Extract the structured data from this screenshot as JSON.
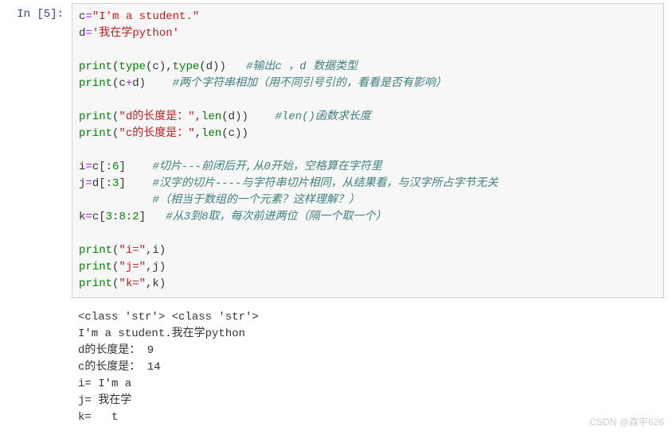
{
  "prompt": "In  [5]:",
  "code": {
    "l1_var": "c",
    "l1_eq": "=",
    "l1_str": "\"I'm a student.\"",
    "l2_var": "d",
    "l2_eq": "=",
    "l2_str": "'我在学python'",
    "l4_print": "print",
    "l4_p1": "(",
    "l4_type1": "type",
    "l4_p2": "(c),",
    "l4_type2": "type",
    "l4_p3": "(d))   ",
    "l4_comment": "#输出c ，d 数据类型",
    "l5_print": "print",
    "l5_p1": "(c",
    "l5_plus": "+",
    "l5_p2": "d)    ",
    "l5_comment": "#两个字符串相加（用不同引号引的，看看是否有影响）",
    "l7_print": "print",
    "l7_p1": "(",
    "l7_str": "\"d的长度是：\"",
    "l7_p2": ",",
    "l7_len": "len",
    "l7_p3": "(d))    ",
    "l7_comment": "#len()函数求长度",
    "l8_print": "print",
    "l8_p1": "(",
    "l8_str": "\"c的长度是：\"",
    "l8_p2": ",",
    "l8_len": "len",
    "l8_p3": "(c))",
    "l10_var": "i",
    "l10_eq": "=",
    "l10_c": "c[:",
    "l10_num": "6",
    "l10_b": "]    ",
    "l10_comment": "#切片---前闭后开,从0开始，空格算在字符里",
    "l11_var": "j",
    "l11_eq": "=",
    "l11_c": "d[:",
    "l11_num": "3",
    "l11_b": "]    ",
    "l11_comment": "#汉字的切片----与字符串切片相同，从结果看，与汉字所占字节无关",
    "l12_pad": "           ",
    "l12_comment": "#（相当于数组的一个元素？这样理解？）",
    "l13_var": "k",
    "l13_eq": "=",
    "l13_c": "c[",
    "l13_n1": "3",
    "l13_col1": ":",
    "l13_n2": "8",
    "l13_col2": ":",
    "l13_n3": "2",
    "l13_b": "]   ",
    "l13_comment": "#从3到8取，每次前进两位（隔一个取一个）",
    "l15_print": "print",
    "l15_p1": "(",
    "l15_str": "\"i=\"",
    "l15_p2": ",i)",
    "l16_print": "print",
    "l16_p1": "(",
    "l16_str": "\"j=\"",
    "l16_p2": ",j)",
    "l17_print": "print",
    "l17_p1": "(",
    "l17_str": "\"k=\"",
    "l17_p2": ",k)"
  },
  "output": {
    "line1": "<class 'str'> <class 'str'>",
    "line2": "I'm a student.我在学python",
    "line3": "d的长度是： 9",
    "line4": "c的长度是： 14",
    "line5": "i= I'm a ",
    "line6": "j= 我在学",
    "line7": "k=   t"
  },
  "watermark": "CSDN @森宇626"
}
